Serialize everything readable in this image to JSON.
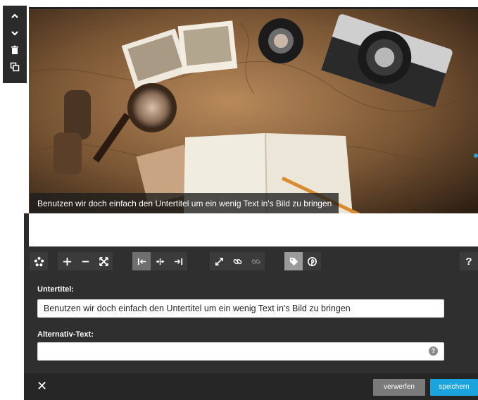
{
  "side_tools": [
    {
      "name": "move-up",
      "icon": "chevron-up-icon"
    },
    {
      "name": "move-down",
      "icon": "chevron-down-icon"
    },
    {
      "name": "delete",
      "icon": "trash-icon"
    },
    {
      "name": "duplicate",
      "icon": "copy-icon"
    }
  ],
  "image": {
    "caption": "Benutzen wir doch einfach den Untertitel um ein wenig Text in's Bild zu bringen"
  },
  "toolbar": {
    "icons": [
      "change-image-icon",
      "zoom-in-icon",
      "zoom-out-icon",
      "fit-icon",
      "align-left-icon",
      "align-center-icon",
      "align-right-icon",
      "fullscreen-icon",
      "link-icon",
      "unlink-icon",
      "tag-icon",
      "pinterest-icon"
    ],
    "help_label": "?"
  },
  "form": {
    "subtitle_label": "Untertitel:",
    "subtitle_value": "Benutzen wir doch einfach den Untertitel um ein wenig Text in's Bild zu bringen",
    "alt_label": "Alternativ-Text:",
    "alt_value": "",
    "alt_help": "?"
  },
  "footer": {
    "close_label": "✕",
    "discard_label": "verwerfen",
    "save_label": "speichern"
  },
  "colors": {
    "panel_bg": "#2f2f2f",
    "save_accent": "#1aa3dd",
    "discard_bg": "#7a7a7a"
  }
}
